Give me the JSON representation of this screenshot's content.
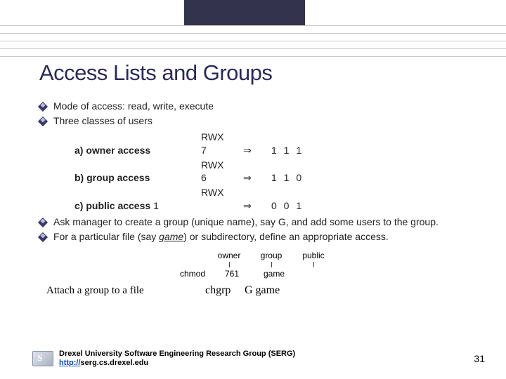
{
  "title": "Access Lists and Groups",
  "bullets": {
    "b1": "Mode of access:  read, write, execute",
    "b2": "Three classes of users",
    "b3": "Ask manager to create a group (unique name), say G, and add some users to the group.",
    "b4_pre": "For a particular file (say ",
    "b4_ital": "game",
    "b4_post": ") or subdirectory, define an appropriate access."
  },
  "access": {
    "rwx": "RWX",
    "rows": [
      {
        "label": "a) owner access",
        "num": "7",
        "arrow": "⇒",
        "bits": "1  1  1"
      },
      {
        "label": "b) group access",
        "num": "6",
        "arrow": "⇒",
        "bits": "1  1  0"
      }
    ],
    "c_label": "c) public access",
    "c_num": "1",
    "c_arrow": "⇒",
    "c_bits": "0  0  1"
  },
  "cmd": {
    "headers": [
      "owner",
      "group",
      "public"
    ],
    "chmod": "chmod",
    "chmod_args": [
      "761",
      "game"
    ],
    "attach_label": "Attach a group to a file",
    "chgrp": "chgrp",
    "chgrp_args": "G    game"
  },
  "footer": {
    "org": "Drexel University Software Engineering Research Group (SERG)",
    "link_prefix": "http://",
    "link_rest": "serg.cs.drexel.edu",
    "page": "31"
  }
}
